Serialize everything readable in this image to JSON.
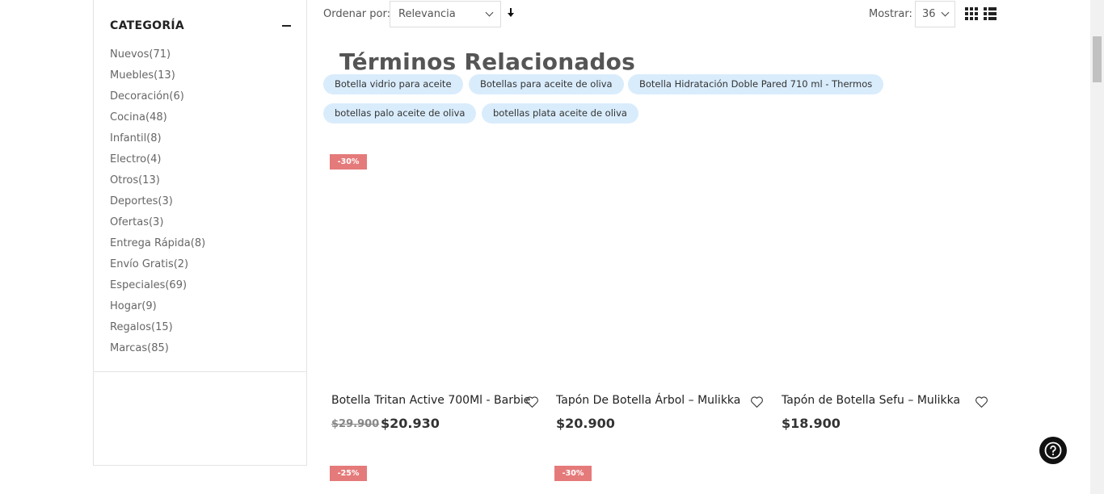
{
  "sidebar": {
    "title": "CATEGORÍA",
    "categories": [
      "Nuevos(71)",
      "Muebles(13)",
      "Decoración(6)",
      "Cocina(48)",
      "Infantil(8)",
      "Electro(4)",
      "Otros(13)",
      "Deportes(3)",
      "Ofertas(3)",
      "Entrega Rápida(8)",
      "Envío Gratis(2)",
      "Especiales(69)",
      "Hogar(9)",
      "Regalos(15)",
      "Marcas(85)"
    ]
  },
  "toolbar": {
    "sort_label": "Ordenar por:",
    "sort_value": "Relevancia",
    "show_label": "Mostrar:",
    "show_value": "36"
  },
  "related": {
    "title": "Términos Relacionados",
    "terms": [
      "Botella vidrio para aceite",
      "Botellas para aceite de oliva",
      "Botella Hidratación Doble Pared 710 ml - Thermos",
      "botellas palo aceite de oliva",
      "botellas plata aceite de oliva"
    ]
  },
  "products": [
    {
      "badge": "-30%",
      "name": "Botella Tritan Active 700Ml - Barbie",
      "old_price": "$29.900",
      "price": "$20.930"
    },
    {
      "badge": "",
      "name": "Tapón De Botella Árbol – Mulikka",
      "old_price": "",
      "price": "$20.900"
    },
    {
      "badge": "",
      "name": "Tapón de Botella Sefu – Mulikka",
      "old_price": "",
      "price": "$18.900"
    }
  ],
  "next_row_badges": [
    "-25%",
    "-30%"
  ],
  "colors": {
    "badge": "#e57a7a",
    "chip": "#d9ecfc",
    "help": "#111111"
  }
}
